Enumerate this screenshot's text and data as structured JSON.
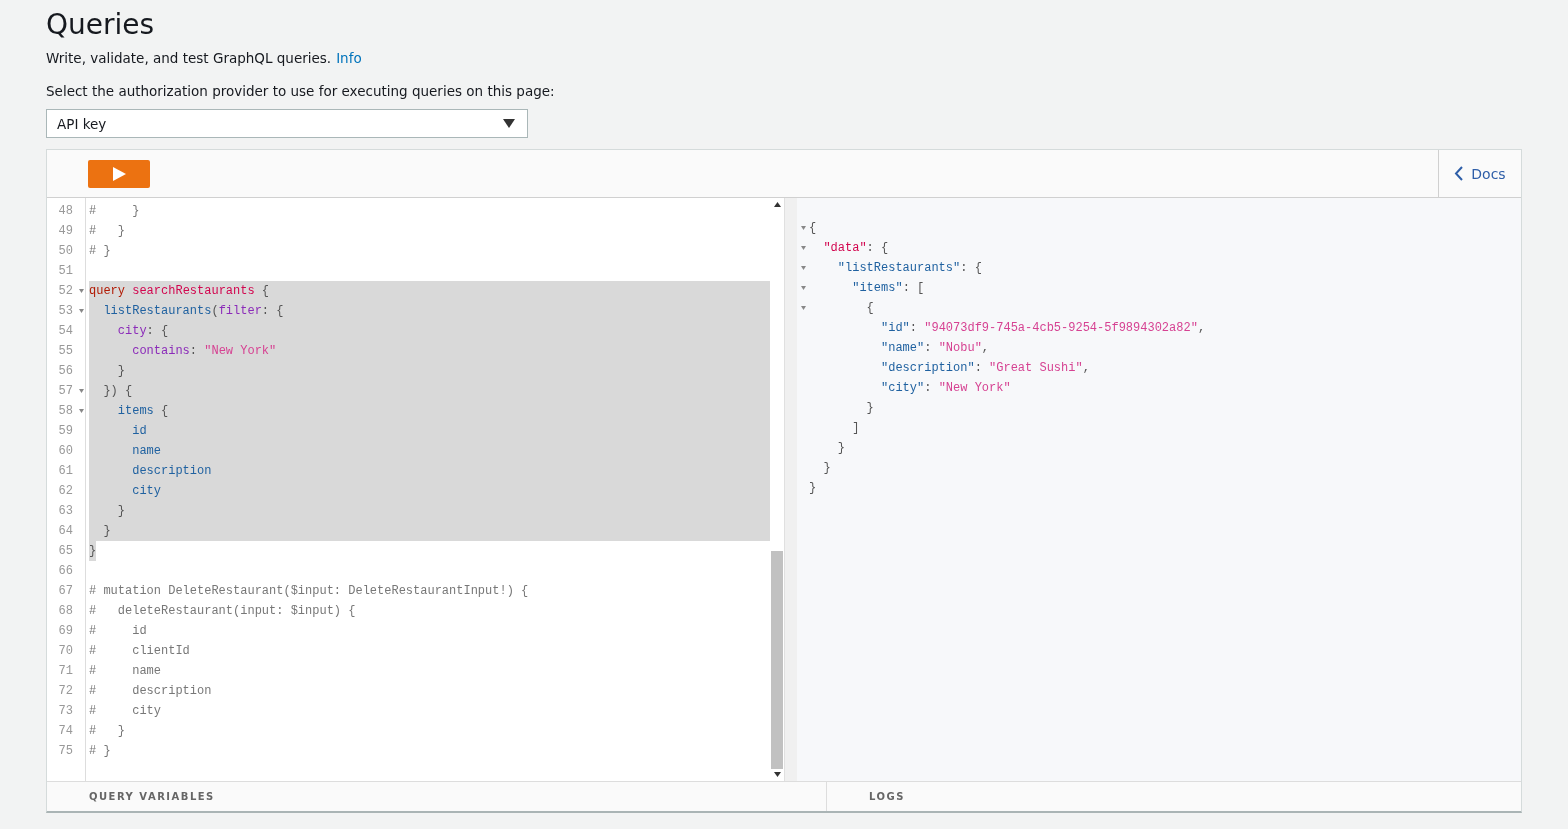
{
  "page": {
    "title": "Queries",
    "description": "Write, validate, and test GraphQL queries.",
    "info_link": "Info"
  },
  "auth": {
    "label": "Select the authorization provider to use for executing queries on this page:",
    "value": "API key"
  },
  "toolbar": {
    "docs_label": "Docs"
  },
  "editor": {
    "lines": [
      {
        "number": "48",
        "foldable": false,
        "selected": false,
        "tokens": [
          {
            "kind": "comment",
            "text": "#     }"
          }
        ]
      },
      {
        "number": "49",
        "foldable": false,
        "selected": false,
        "tokens": [
          {
            "kind": "comment",
            "text": "#   }"
          }
        ]
      },
      {
        "number": "50",
        "foldable": false,
        "selected": false,
        "tokens": [
          {
            "kind": "comment",
            "text": "# }"
          }
        ]
      },
      {
        "number": "51",
        "foldable": false,
        "selected": false
      },
      {
        "number": "52",
        "foldable": true,
        "selected": true,
        "tokens": [
          {
            "kind": "keyword",
            "text": "query"
          },
          {
            "kind": "def",
            "text": " searchRestaurants"
          },
          {
            "kind": "punct",
            "text": " {"
          }
        ]
      },
      {
        "number": "53",
        "foldable": true,
        "selected": true,
        "tokens": [
          {
            "kind": "field",
            "text": "  listRestaurants"
          },
          {
            "kind": "punct",
            "text": "("
          },
          {
            "kind": "attr",
            "text": "filter"
          },
          {
            "kind": "punct",
            "text": ": {"
          }
        ]
      },
      {
        "number": "54",
        "foldable": false,
        "selected": true,
        "tokens": [
          {
            "kind": "attr",
            "text": "    city"
          },
          {
            "kind": "punct",
            "text": ": {"
          }
        ]
      },
      {
        "number": "55",
        "foldable": false,
        "selected": true,
        "tokens": [
          {
            "kind": "attr",
            "text": "      contains"
          },
          {
            "kind": "punct",
            "text": ": "
          },
          {
            "kind": "string",
            "text": "\"New York\""
          }
        ]
      },
      {
        "number": "56",
        "foldable": false,
        "selected": true,
        "tokens": [
          {
            "kind": "punct",
            "text": "    }"
          }
        ]
      },
      {
        "number": "57",
        "foldable": true,
        "selected": true,
        "tokens": [
          {
            "kind": "punct",
            "text": "  }) {"
          }
        ]
      },
      {
        "number": "58",
        "foldable": true,
        "selected": true,
        "tokens": [
          {
            "kind": "field",
            "text": "    items"
          },
          {
            "kind": "punct",
            "text": " {"
          }
        ]
      },
      {
        "number": "59",
        "foldable": false,
        "selected": true,
        "tokens": [
          {
            "kind": "field",
            "text": "      id"
          }
        ]
      },
      {
        "number": "60",
        "foldable": false,
        "selected": true,
        "tokens": [
          {
            "kind": "field",
            "text": "      name"
          }
        ]
      },
      {
        "number": "61",
        "foldable": false,
        "selected": true,
        "tokens": [
          {
            "kind": "field",
            "text": "      description"
          }
        ]
      },
      {
        "number": "62",
        "foldable": false,
        "selected": true,
        "tokens": [
          {
            "kind": "field",
            "text": "      city"
          }
        ]
      },
      {
        "number": "63",
        "foldable": false,
        "selected": true,
        "tokens": [
          {
            "kind": "punct",
            "text": "    }"
          }
        ]
      },
      {
        "number": "64",
        "foldable": false,
        "selected": true,
        "tokens": [
          {
            "kind": "punct",
            "text": "  }"
          }
        ]
      },
      {
        "number": "65",
        "foldable": false,
        "selected": true,
        "tokens": [
          {
            "kind": "punct",
            "text": "}"
          }
        ]
      },
      {
        "number": "66",
        "foldable": false,
        "selected": false
      },
      {
        "number": "67",
        "foldable": false,
        "selected": false,
        "tokens": [
          {
            "kind": "comment",
            "text": "# mutation DeleteRestaurant($input: DeleteRestaurantInput!) {"
          }
        ]
      },
      {
        "number": "68",
        "foldable": false,
        "selected": false,
        "tokens": [
          {
            "kind": "comment",
            "text": "#   deleteRestaurant(input: $input) {"
          }
        ]
      },
      {
        "number": "69",
        "foldable": false,
        "selected": false,
        "tokens": [
          {
            "kind": "comment",
            "text": "#     id"
          }
        ]
      },
      {
        "number": "70",
        "foldable": false,
        "selected": false,
        "tokens": [
          {
            "kind": "comment",
            "text": "#     clientId"
          }
        ]
      },
      {
        "number": "71",
        "foldable": false,
        "selected": false,
        "tokens": [
          {
            "kind": "comment",
            "text": "#     name"
          }
        ]
      },
      {
        "number": "72",
        "foldable": false,
        "selected": false,
        "tokens": [
          {
            "kind": "comment",
            "text": "#     description"
          }
        ]
      },
      {
        "number": "73",
        "foldable": false,
        "selected": false,
        "tokens": [
          {
            "kind": "comment",
            "text": "#     city"
          }
        ]
      },
      {
        "number": "74",
        "foldable": false,
        "selected": false,
        "tokens": [
          {
            "kind": "comment",
            "text": "#   }"
          }
        ]
      },
      {
        "number": "75",
        "foldable": false,
        "selected": false,
        "tokens": [
          {
            "kind": "comment",
            "text": "# }"
          }
        ]
      }
    ]
  },
  "result": {
    "lines": [
      {
        "foldable": true,
        "tokens": [
          {
            "kind": "punct",
            "text": "{"
          }
        ]
      },
      {
        "foldable": true,
        "tokens": [
          {
            "kind": "def",
            "text": "  \"data\""
          },
          {
            "kind": "punct",
            "text": ": {"
          }
        ]
      },
      {
        "foldable": true,
        "tokens": [
          {
            "kind": "field",
            "text": "    \"listRestaurants\""
          },
          {
            "kind": "punct",
            "text": ": {"
          }
        ]
      },
      {
        "foldable": true,
        "tokens": [
          {
            "kind": "field",
            "text": "      \"items\""
          },
          {
            "kind": "punct",
            "text": ": ["
          }
        ]
      },
      {
        "foldable": true,
        "tokens": [
          {
            "kind": "punct",
            "text": "        {"
          }
        ]
      },
      {
        "foldable": false,
        "tokens": [
          {
            "kind": "field",
            "text": "          \"id\""
          },
          {
            "kind": "punct",
            "text": ": "
          },
          {
            "kind": "string",
            "text": "\"94073df9-745a-4cb5-9254-5f9894302a82\""
          },
          {
            "kind": "punct",
            "text": ","
          }
        ]
      },
      {
        "foldable": false,
        "tokens": [
          {
            "kind": "field",
            "text": "          \"name\""
          },
          {
            "kind": "punct",
            "text": ": "
          },
          {
            "kind": "string",
            "text": "\"Nobu\""
          },
          {
            "kind": "punct",
            "text": ","
          }
        ]
      },
      {
        "foldable": false,
        "tokens": [
          {
            "kind": "field",
            "text": "          \"description\""
          },
          {
            "kind": "punct",
            "text": ": "
          },
          {
            "kind": "string",
            "text": "\"Great Sushi\""
          },
          {
            "kind": "punct",
            "text": ","
          }
        ]
      },
      {
        "foldable": false,
        "tokens": [
          {
            "kind": "field",
            "text": "          \"city\""
          },
          {
            "kind": "punct",
            "text": ": "
          },
          {
            "kind": "string",
            "text": "\"New York\""
          }
        ]
      },
      {
        "foldable": false,
        "tokens": [
          {
            "kind": "punct",
            "text": "        }"
          }
        ]
      },
      {
        "foldable": false,
        "tokens": [
          {
            "kind": "punct",
            "text": "      ]"
          }
        ]
      },
      {
        "foldable": false,
        "tokens": [
          {
            "kind": "punct",
            "text": "    }"
          }
        ]
      },
      {
        "foldable": false,
        "tokens": [
          {
            "kind": "punct",
            "text": "  }"
          }
        ]
      },
      {
        "foldable": false,
        "tokens": [
          {
            "kind": "punct",
            "text": "}"
          }
        ]
      }
    ]
  },
  "bottom": {
    "query_variables": "QUERY VARIABLES",
    "logs": "LOGS"
  }
}
